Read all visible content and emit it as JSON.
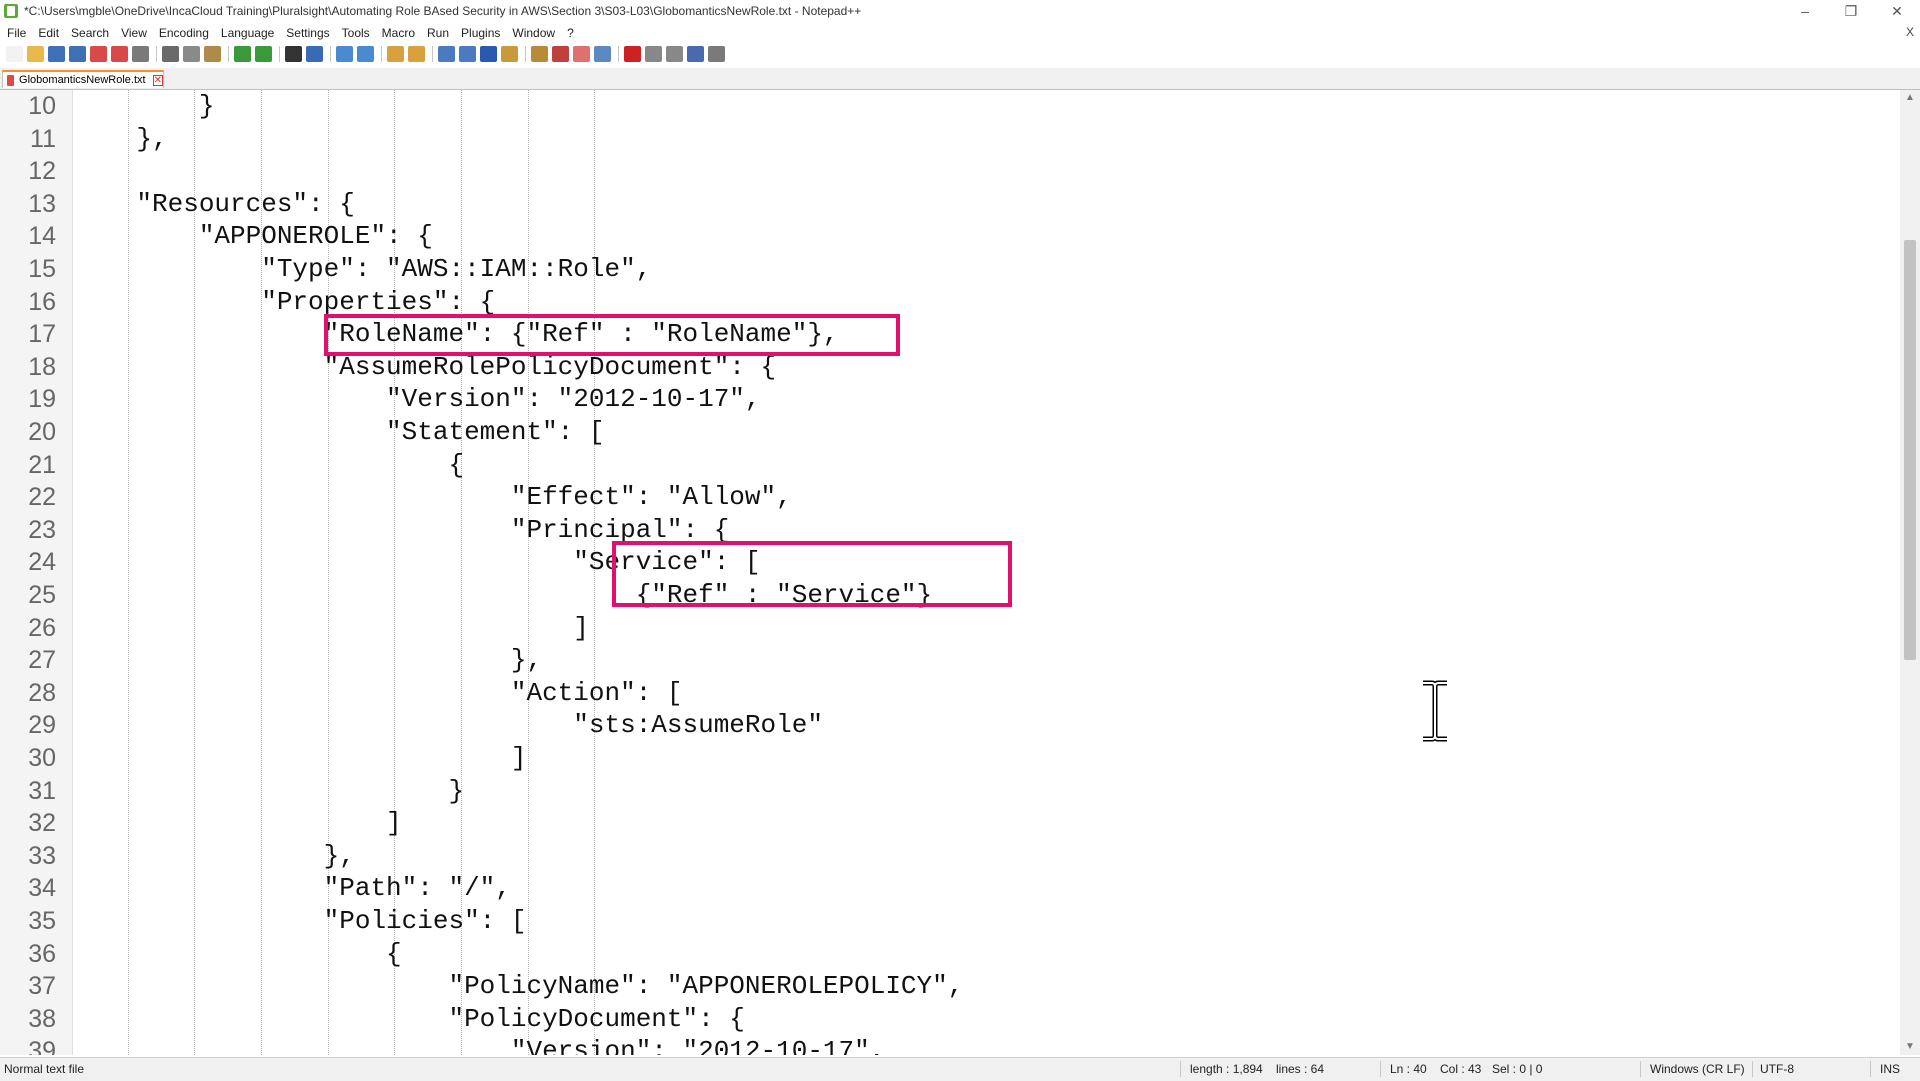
{
  "window": {
    "title": "*C:\\Users\\mgble\\OneDrive\\IncaCloud Training\\Pluralsight\\Automating Role BAsed Security in AWS\\Section 3\\S03-L03\\GlobomanticsNewRole.txt - Notepad++",
    "minimize": "–",
    "restore": "❐",
    "close": "✕"
  },
  "menu": {
    "items": [
      "File",
      "Edit",
      "Search",
      "View",
      "Encoding",
      "Language",
      "Settings",
      "Tools",
      "Macro",
      "Run",
      "Plugins",
      "Window",
      "?"
    ],
    "close_glyph": "X"
  },
  "toolbar": {
    "buttons": [
      {
        "icon": "new-file-icon",
        "color": "#f2f2f2"
      },
      {
        "icon": "open-file-icon",
        "color": "#e8b84a"
      },
      {
        "icon": "save-icon",
        "color": "#3f6fb5"
      },
      {
        "icon": "save-all-icon",
        "color": "#3f6fb5"
      },
      {
        "icon": "close-icon",
        "color": "#d84a4a"
      },
      {
        "icon": "close-all-icon",
        "color": "#d84a4a"
      },
      {
        "icon": "print-icon",
        "color": "#7a7a7a"
      },
      {
        "icon": "cut-icon",
        "color": "#6a6a6a"
      },
      {
        "icon": "copy-icon",
        "color": "#8a8a8a"
      },
      {
        "icon": "paste-icon",
        "color": "#b08a4a"
      },
      {
        "icon": "undo-icon",
        "color": "#3a9a3a"
      },
      {
        "icon": "redo-icon",
        "color": "#3a9a3a"
      },
      {
        "icon": "find-icon",
        "color": "#333333"
      },
      {
        "icon": "replace-icon",
        "color": "#3a6ab5"
      },
      {
        "icon": "zoom-in-icon",
        "color": "#4a8ad0"
      },
      {
        "icon": "zoom-out-icon",
        "color": "#4a8ad0"
      },
      {
        "icon": "sync-v-icon",
        "color": "#d9a040"
      },
      {
        "icon": "sync-h-icon",
        "color": "#d9a040"
      },
      {
        "icon": "word-wrap-icon",
        "color": "#4a7ac0"
      },
      {
        "icon": "all-chars-icon",
        "color": "#4a7ac0"
      },
      {
        "icon": "indent-guide-icon",
        "color": "#2a5ab0"
      },
      {
        "icon": "udl-icon",
        "color": "#c89a3a"
      },
      {
        "icon": "doc-map-icon",
        "color": "#b88a3a"
      },
      {
        "icon": "function-list-icon",
        "color": "#c04040"
      },
      {
        "icon": "folder-workspace-icon",
        "color": "#e07070"
      },
      {
        "icon": "monitoring-icon",
        "color": "#5a8ac0"
      },
      {
        "icon": "record-macro-icon",
        "color": "#cc2222"
      },
      {
        "icon": "stop-macro-icon",
        "color": "#888888"
      },
      {
        "icon": "play-macro-icon",
        "color": "#888888"
      },
      {
        "icon": "run-macro-multiple-icon",
        "color": "#4a6ab0"
      },
      {
        "icon": "save-macro-icon",
        "color": "#7a7a7a"
      }
    ]
  },
  "tab": {
    "label": "GlobomanticsNewRole.txt",
    "close_glyph": "✕"
  },
  "editor": {
    "lines": [
      {
        "n": "10",
        "text": "        }"
      },
      {
        "n": "11",
        "text": "    },"
      },
      {
        "n": "12",
        "text": ""
      },
      {
        "n": "13",
        "text": "    \"Resources\": {"
      },
      {
        "n": "14",
        "text": "        \"APPONEROLE\": {"
      },
      {
        "n": "15",
        "text": "            \"Type\": \"AWS::IAM::Role\","
      },
      {
        "n": "16",
        "text": "            \"Properties\": {"
      },
      {
        "n": "17",
        "text": "                \"RoleName\": {\"Ref\" : \"RoleName\"},"
      },
      {
        "n": "18",
        "text": "                \"AssumeRolePolicyDocument\": {"
      },
      {
        "n": "19",
        "text": "                    \"Version\": \"2012-10-17\","
      },
      {
        "n": "20",
        "text": "                    \"Statement\": ["
      },
      {
        "n": "21",
        "text": "                        {"
      },
      {
        "n": "22",
        "text": "                            \"Effect\": \"Allow\","
      },
      {
        "n": "23",
        "text": "                            \"Principal\": {"
      },
      {
        "n": "24",
        "text": "                                \"Service\": ["
      },
      {
        "n": "25",
        "text": "                                    {\"Ref\" : \"Service\"}"
      },
      {
        "n": "26",
        "text": "                                ]"
      },
      {
        "n": "27",
        "text": "                            },"
      },
      {
        "n": "28",
        "text": "                            \"Action\": ["
      },
      {
        "n": "29",
        "text": "                                \"sts:AssumeRole\""
      },
      {
        "n": "30",
        "text": "                            ]"
      },
      {
        "n": "31",
        "text": "                        }"
      },
      {
        "n": "32",
        "text": "                    ]"
      },
      {
        "n": "33",
        "text": "                },"
      },
      {
        "n": "34",
        "text": "                \"Path\": \"/\","
      },
      {
        "n": "35",
        "text": "                \"Policies\": ["
      },
      {
        "n": "36",
        "text": "                    {"
      },
      {
        "n": "37",
        "text": "                        \"PolicyName\": \"APPONEROLEPOLICY\","
      },
      {
        "n": "38",
        "text": "                        \"PolicyDocument\": {"
      },
      {
        "n": "39",
        "text": "                            \"Version\": \"2012-10-17\","
      }
    ],
    "highlight_color": "#e0106e"
  },
  "statusbar": {
    "file_type": "Normal text file",
    "length": "length : 1,894",
    "lines": "lines : 64",
    "ln": "Ln : 40",
    "col": "Col : 43",
    "sel": "Sel : 0 | 0",
    "eol": "Windows (CR LF)",
    "encoding": "UTF-8",
    "mode": "INS"
  }
}
